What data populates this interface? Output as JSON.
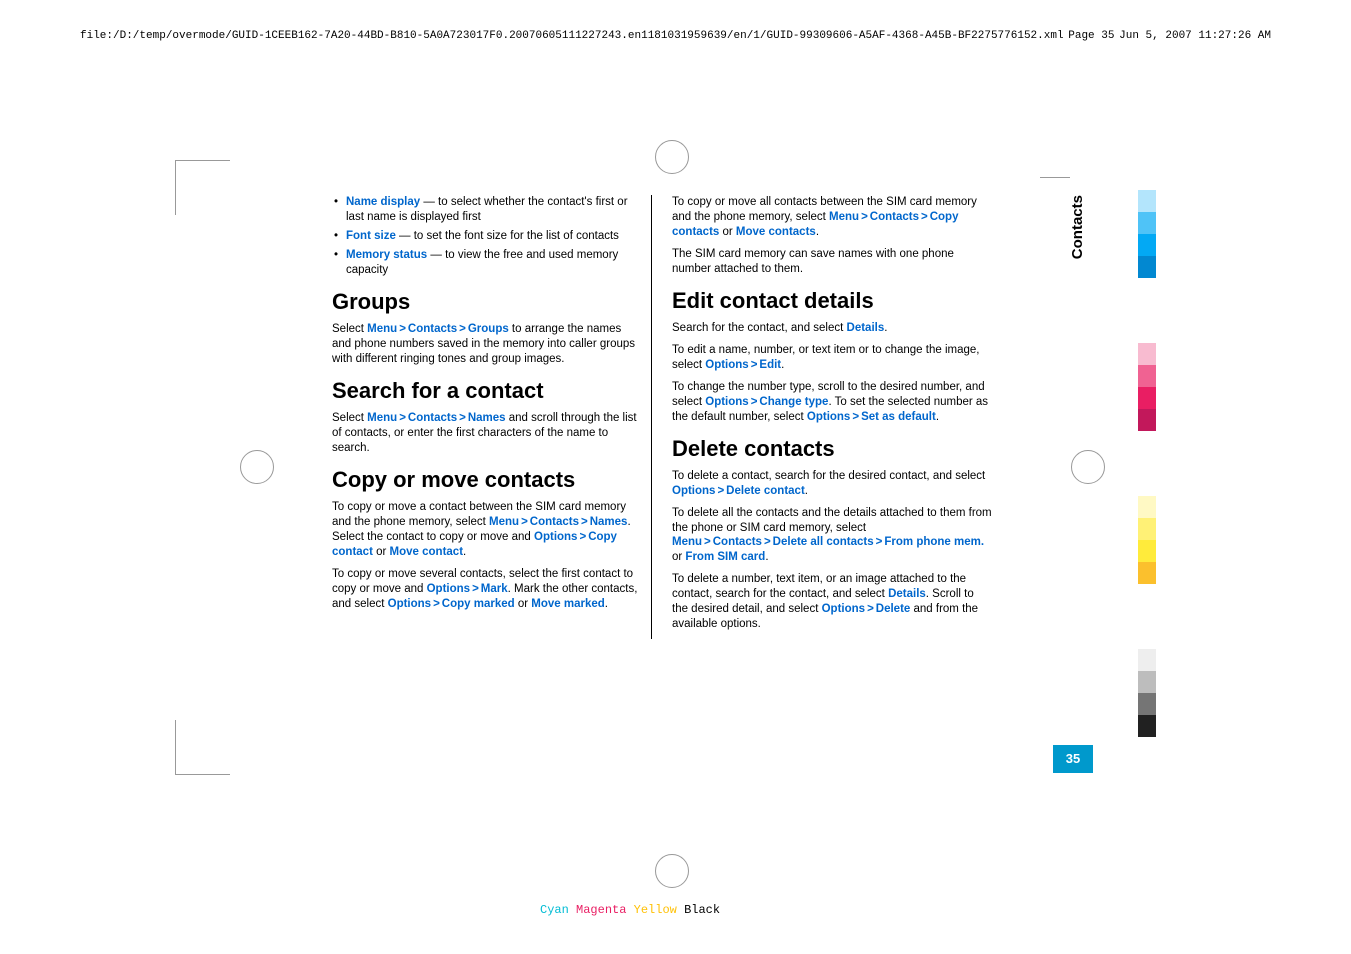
{
  "header": {
    "path": "file:/D:/temp/overmode/GUID-1CEEB162-7A20-44BD-B810-5A0A723017F0.20070605111227243.en1181031959639/en/1/GUID-99309606-A5AF-4368-A45B-BF2275776152.xml",
    "page": "Page 35",
    "date": "Jun 5, 2007 11:27:26 AM"
  },
  "left_col": {
    "bullets": [
      {
        "blue": "Name display",
        "dash": " —  ",
        "text": "to select whether the contact's first or last name is displayed first"
      },
      {
        "blue": "Font size",
        "dash": "  — ",
        "text": "to set the font size for the list of contacts"
      },
      {
        "blue": "Memory status",
        "dash": " —  ",
        "text": "to view the free and used memory capacity"
      }
    ],
    "h_groups": "Groups",
    "groups_p1": {
      "pre": "Select ",
      "b1": "Menu",
      "b2": "Contacts",
      "b3": "Groups",
      "post": " to arrange the names and phone numbers saved in the memory into caller groups with different ringing tones and group images."
    },
    "h_search": "Search for a contact",
    "search_p1": {
      "pre": "Select ",
      "b1": "Menu",
      "b2": "Contacts",
      "b3": "Names",
      "post": " and scroll through the list of contacts, or enter the first characters of the name to search."
    },
    "h_copy": "Copy or move contacts",
    "copy_p1": {
      "pre": "To copy or move a contact between the SIM card memory and the phone memory, select ",
      "b1": "Menu",
      "b2": "Contacts",
      "b3": "Names",
      "mid": ". Select the contact to copy or move and ",
      "b4": "Options",
      "b5": "Copy contact",
      "or": " or ",
      "b6": "Move contact",
      "end": "."
    },
    "copy_p2": {
      "pre": "To copy or move several contacts, select the first contact to copy or move and ",
      "b1": "Options",
      "b2": "Mark",
      "mid": ". Mark the other contacts, and select ",
      "b3": "Options",
      "b4": "Copy marked",
      "or": " or ",
      "b5": "Move marked",
      "end": "."
    }
  },
  "right_col": {
    "top_p1": {
      "pre": "To copy or move all contacts between the SIM card memory and the phone memory, select ",
      "b1": "Menu",
      "b2": "Contacts",
      "b3": "Copy contacts",
      "or": " or ",
      "b4": "Move contacts",
      "end": "."
    },
    "top_p2": "The SIM card memory can save names with one phone number attached to them.",
    "h_edit": "Edit contact details",
    "edit_p1": {
      "pre": "Search for the contact, and select ",
      "b1": "Details",
      "end": "."
    },
    "edit_p2": {
      "pre": "To edit a name, number, or text item or to change the image, select ",
      "b1": "Options",
      "b2": "Edit",
      "end": "."
    },
    "edit_p3": {
      "pre": "To change the number type, scroll to the desired number, and select ",
      "b1": "Options",
      "b2": "Change type",
      "mid": ". To set the selected number as the default number, select ",
      "b3": "Options",
      "b4": "Set as default",
      "end": "."
    },
    "h_delete": "Delete contacts",
    "del_p1": {
      "pre": "To delete a contact, search for the desired contact, and select ",
      "b1": "Options",
      "b2": "Delete contact",
      "end": "."
    },
    "del_p2": {
      "pre": "To delete all the contacts and the details attached to them from the phone or SIM card memory, select ",
      "b1": "Menu",
      "b2": "Contacts",
      "b3": "Delete all contacts",
      "b4": "From phone mem.",
      "or": " or ",
      "b5": "From SIM card",
      "end": "."
    },
    "del_p3": {
      "pre": "To delete a number, text item, or an image attached to the contact, search for the contact, and select ",
      "b1": "Details",
      "mid": ". Scroll to the desired detail, and select ",
      "b2": "Options",
      "b3": "Delete",
      "post": " and from the available options."
    }
  },
  "side_tab": "Contacts",
  "page_num": "35",
  "footer": {
    "c": "Cyan",
    "m": "Magenta",
    "y": "Yellow",
    "k": "Black"
  }
}
